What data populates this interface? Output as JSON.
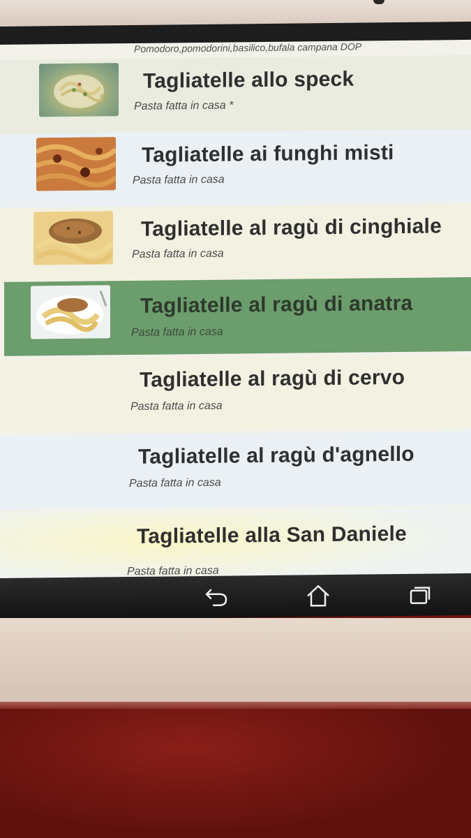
{
  "previous_item": {
    "subtitle": "Pomodoro,pomodorini,basilico,bufala campana DOP"
  },
  "menu_items": [
    {
      "title": "Tagliatelle allo speck",
      "subtitle": "Pasta fatta in casa *",
      "has_image": true,
      "image_desc": "tagliatelle-speck-photo"
    },
    {
      "title": "Tagliatelle ai funghi misti",
      "subtitle": "Pasta fatta in casa",
      "has_image": true,
      "image_desc": "tagliatelle-mushrooms-photo"
    },
    {
      "title": "Tagliatelle al ragù di cinghiale",
      "subtitle": "Pasta fatta in casa",
      "has_image": true,
      "image_desc": "tagliatelle-boar-ragu-photo"
    },
    {
      "title": "Tagliatelle al ragù di anatra",
      "subtitle": "Pasta fatta in casa",
      "has_image": true,
      "image_desc": "tagliatelle-duck-ragu-photo",
      "selected": true
    },
    {
      "title": "Tagliatelle al ragù di cervo",
      "subtitle": "Pasta fatta in casa",
      "has_image": false
    },
    {
      "title": "Tagliatelle al ragù d'agnello",
      "subtitle": "Pasta fatta in casa",
      "has_image": false
    },
    {
      "title": "Tagliatelle alla San Daniele",
      "subtitle": "Pasta fatta in casa",
      "has_image": false
    }
  ],
  "navbar": {
    "back_icon": "back-arrow-icon",
    "home_icon": "home-icon",
    "recents_icon": "recent-apps-icon"
  },
  "colors": {
    "selected_row": "#6c9d6c",
    "title_text": "#2f2f2f",
    "navbar_bg": "#1a1a1a"
  }
}
